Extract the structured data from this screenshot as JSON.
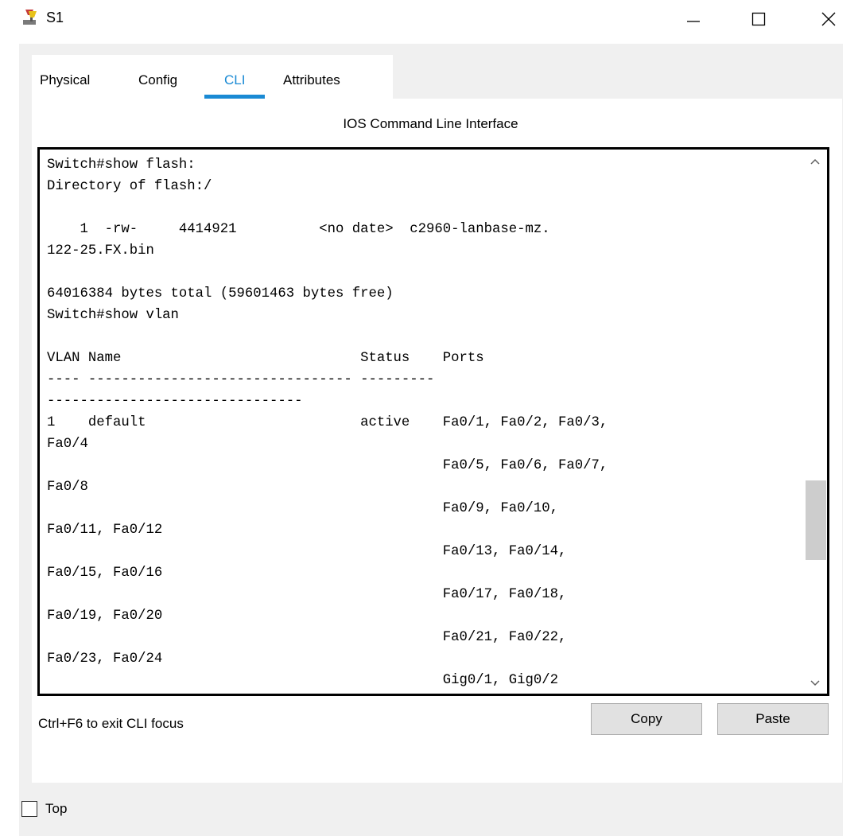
{
  "window": {
    "title": "S1",
    "icon": "packet-tracer-switch-icon"
  },
  "tabs": [
    {
      "label": "Physical",
      "active": false
    },
    {
      "label": "Config",
      "active": false
    },
    {
      "label": "CLI",
      "active": true
    },
    {
      "label": "Attributes",
      "active": false
    }
  ],
  "cli": {
    "header": "IOS Command Line Interface",
    "lines": [
      "Switch#show flash:",
      "Directory of flash:/",
      "",
      "    1  -rw-     4414921          <no date>  c2960-lanbase-mz.",
      "122-25.FX.bin",
      "",
      "64016384 bytes total (59601463 bytes free)",
      "Switch#show vlan",
      "",
      "VLAN Name                             Status    Ports",
      "---- -------------------------------- ---------",
      "-------------------------------",
      "1    default                          active    Fa0/1, Fa0/2, Fa0/3,",
      "Fa0/4",
      "                                                Fa0/5, Fa0/6, Fa0/7,",
      "Fa0/8",
      "                                                Fa0/9, Fa0/10,",
      "Fa0/11, Fa0/12",
      "                                                Fa0/13, Fa0/14,",
      "Fa0/15, Fa0/16",
      "                                                Fa0/17, Fa0/18,",
      "Fa0/19, Fa0/20",
      "                                                Fa0/21, Fa0/22,",
      "Fa0/23, Fa0/24",
      "                                                Gig0/1, Gig0/2"
    ]
  },
  "status": {
    "hint": "Ctrl+F6 to exit CLI focus"
  },
  "buttons": {
    "copy": "Copy",
    "paste": "Paste"
  },
  "footer": {
    "top_label": "Top",
    "top_checked": false
  },
  "colors": {
    "accent": "#1a8ad4",
    "panel": "#f0f0f0"
  }
}
